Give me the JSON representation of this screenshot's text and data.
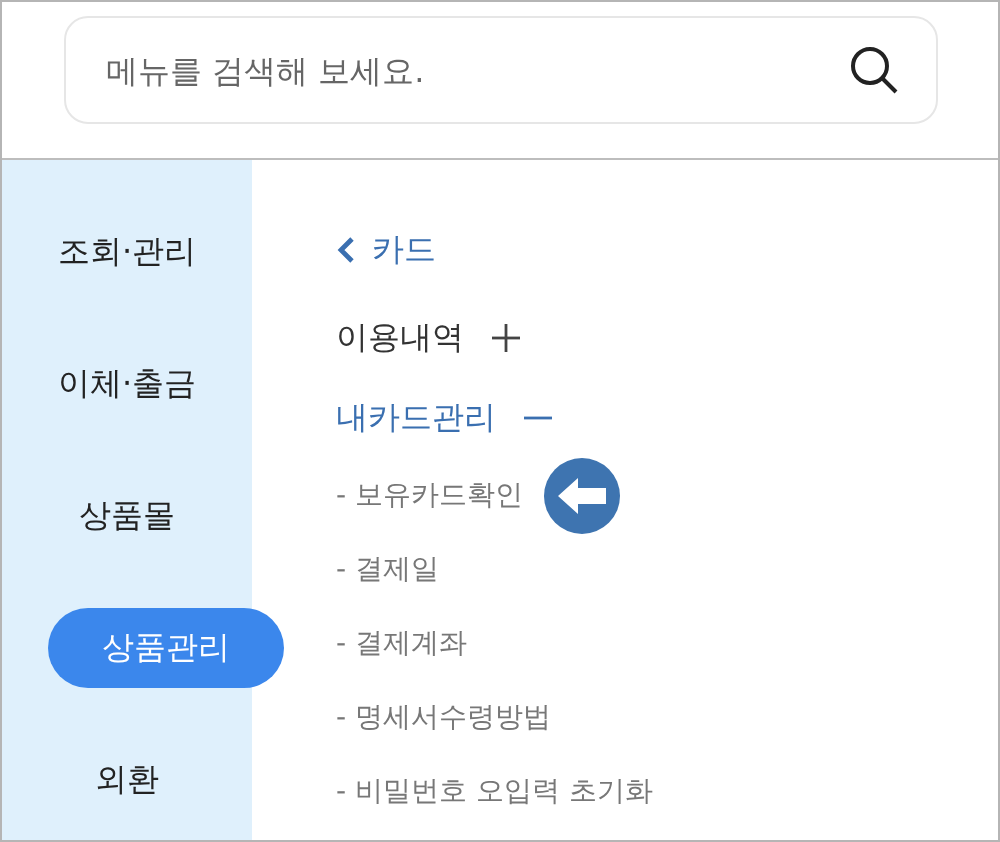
{
  "search": {
    "placeholder": "메뉴를 검색해 보세요."
  },
  "sidebar": {
    "items": [
      {
        "label": "조회·관리",
        "selected": false
      },
      {
        "label": "이체·출금",
        "selected": false
      },
      {
        "label": "상품몰",
        "selected": false
      },
      {
        "label": "상품관리",
        "selected": true
      },
      {
        "label": "외환",
        "selected": false
      }
    ]
  },
  "content": {
    "back": {
      "label": "카드"
    },
    "groups": [
      {
        "label": "이용내역",
        "expanded": false
      },
      {
        "label": "내카드관리",
        "expanded": true,
        "children": [
          {
            "label": "- 보유카드확인",
            "pointed": true
          },
          {
            "label": "- 결제일",
            "pointed": false
          },
          {
            "label": "- 결제계좌",
            "pointed": false
          },
          {
            "label": "- 명세서수령방법",
            "pointed": false
          },
          {
            "label": "- 비밀번호 오입력 초기화",
            "pointed": false
          }
        ]
      }
    ]
  }
}
